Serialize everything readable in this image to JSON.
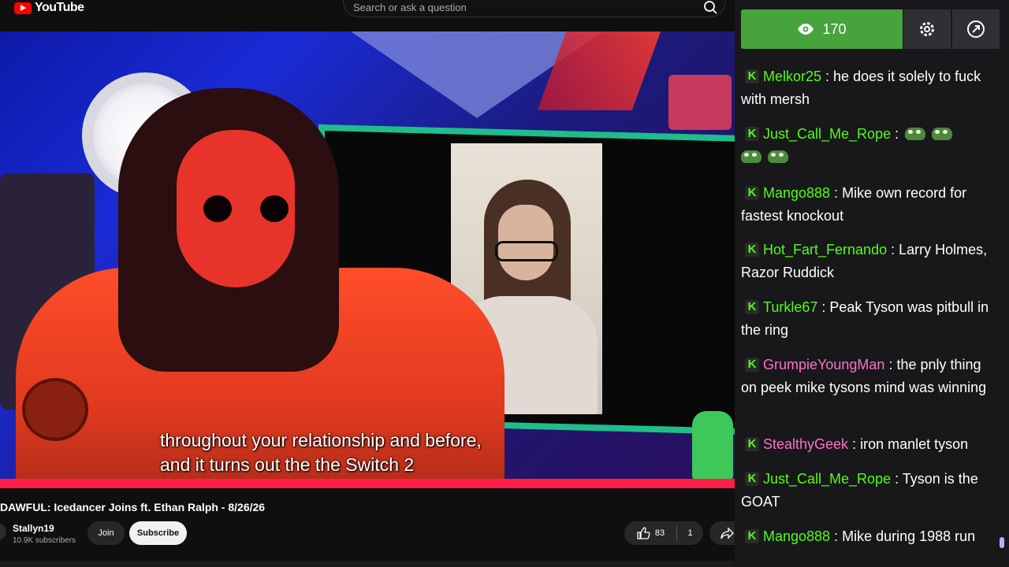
{
  "app": {
    "logo_text": "YouTube",
    "brand_color": "#ff0000"
  },
  "search": {
    "placeholder": "Search or ask a question"
  },
  "video": {
    "caption_line1": "throughout your relationship and before,",
    "caption_line2": "and it turns out the the Switch 2",
    "title": "DAWFUL: Icedancer Joins ft. Ethan Ralph - 8/26/26",
    "progress_color": "#ff1e48"
  },
  "channel": {
    "name": "Stallyn19",
    "subscribers": "10.9K subscribers",
    "join_label": "Join",
    "subscribe_label": "Subscribe"
  },
  "actions": {
    "likes": "83",
    "dislikes": "1",
    "like_icon": "thumbs-up-icon",
    "share_icon": "share-icon"
  },
  "chat_header": {
    "viewer_count": "170",
    "viewer_icon": "eye-icon",
    "settings_icon": "gear-icon",
    "popout_icon": "popout-icon",
    "accent": "#47a33b"
  },
  "chat": {
    "badge": "K",
    "badge_color": "#53fc18",
    "messages": [
      {
        "user": "Melkor25",
        "color": "#53fc18",
        "text": "he does it solely to fuck with mersh"
      },
      {
        "user": "Just_Call_Me_Rope",
        "color": "#53fc18",
        "text": ""
      },
      {
        "user": "Mango888",
        "color": "#53fc18",
        "text": "Mike own record for fastest knockout"
      },
      {
        "user": "Hot_Fart_Fernando",
        "color": "#53fc18",
        "text": "Larry Holmes, Razor Ruddick"
      },
      {
        "user": "Turkle67",
        "color": "#53fc18",
        "text": "Peak Tyson was pitbull in the ring"
      },
      {
        "user": "GrumpieYoungMan",
        "color": "#ff6ec7",
        "text": "the pnly thing on peek mike tysons mind was winning"
      },
      {
        "user": "StealthyGeek",
        "color": "#ff6ec7",
        "text": "iron manlet tyson"
      },
      {
        "user": "Just_Call_Me_Rope",
        "color": "#53fc18",
        "text": "Tyson is the GOAT"
      },
      {
        "user": "Mango888",
        "color": "#53fc18",
        "text": "Mike during 1988 run"
      }
    ]
  }
}
